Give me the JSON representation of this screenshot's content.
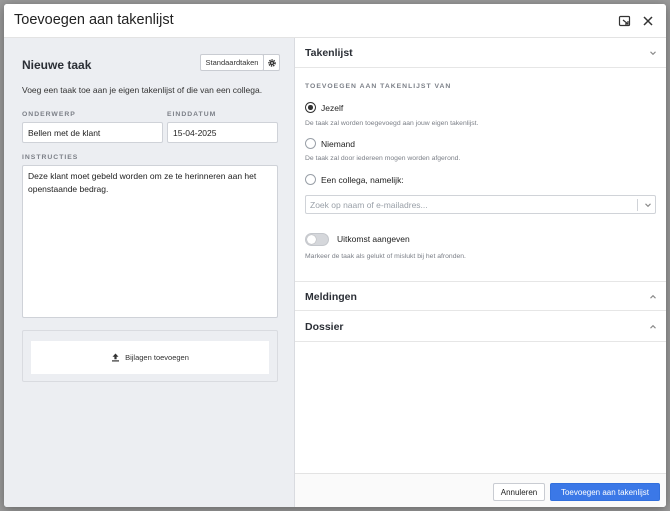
{
  "modal": {
    "title": "Toevoegen aan takenlijst"
  },
  "left_panel": {
    "title": "Nieuwe taak",
    "standard_tasks_label": "Standaardtaken",
    "intro": "Voeg een taak toe aan je eigen takenlijst of die van een collega.",
    "subject_label": "ONDERWERP",
    "subject_value": "Bellen met de klant",
    "due_date_label": "EINDDATUM",
    "due_date_value": "15-04-2025",
    "instructions_label": "INSTRUCTIES",
    "instructions_value": "Deze klant moet gebeld worden om ze te herinneren aan het openstaande bedrag.",
    "attachments_label": "Bijlagen toevoegen"
  },
  "right_panel": {
    "tasklist_title": "Takenlijst",
    "add_to_label": "TOEVOEGEN AAN TAKENLIJST VAN",
    "options": [
      {
        "label": "Jezelf",
        "hint": "De taak zal worden toegevoegd aan jouw eigen takenlijst.",
        "checked": true
      },
      {
        "label": "Niemand",
        "hint": "De taak zal door iedereen mogen worden afgerond.",
        "checked": false
      },
      {
        "label": "Een collega, namelijk:",
        "hint": "",
        "checked": false
      }
    ],
    "colleague_search_placeholder": "Zoek op naam of e-mailadres...",
    "outcome_toggle_label": "Uitkomst aangeven",
    "outcome_hint": "Markeer de taak als gelukt of mislukt bij het afronden.",
    "notifications_title": "Meldingen",
    "dossier_title": "Dossier"
  },
  "footer": {
    "cancel_label": "Annuleren",
    "submit_label": "Toevoegen aan takenlijst"
  },
  "colors": {
    "accent": "#3b78e7",
    "left_panel_bg": "#eceef2"
  }
}
